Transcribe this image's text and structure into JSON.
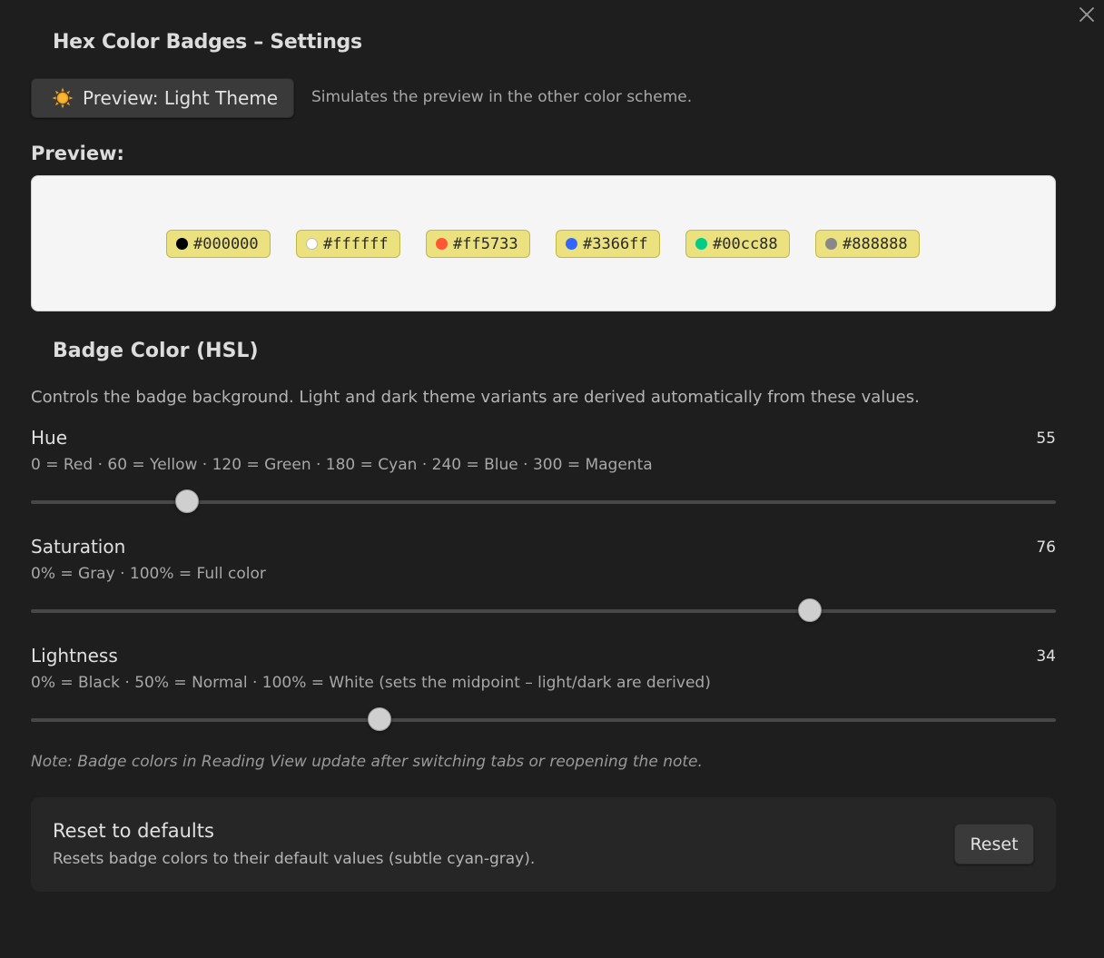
{
  "header": {
    "title": "Hex Color Badges – Settings"
  },
  "icons": {
    "close": "close-icon",
    "theme": "sun-icon"
  },
  "preview_toggle": {
    "label": "Preview: Light Theme",
    "description": "Simulates the preview in the other color scheme."
  },
  "preview": {
    "heading": "Preview:",
    "background": "#f5f5f5",
    "badge_background": "#ebe17e",
    "badges": [
      {
        "label": "#000000",
        "color": "#000000"
      },
      {
        "label": "#ffffff",
        "color": "#ffffff"
      },
      {
        "label": "#ff5733",
        "color": "#ff5733"
      },
      {
        "label": "#3366ff",
        "color": "#3366ff"
      },
      {
        "label": "#00cc88",
        "color": "#00cc88"
      },
      {
        "label": "#888888",
        "color": "#888888"
      }
    ]
  },
  "badge_color": {
    "title": "Badge Color (HSL)",
    "description": "Controls the badge background. Light and dark theme variants are derived automatically from these values.",
    "sliders": [
      {
        "label": "Hue",
        "value": "55",
        "numeric": 55,
        "min": 0,
        "max": 360,
        "hint": "0 = Red · 60 = Yellow · 120 = Green · 180 = Cyan · 240 = Blue · 300 = Magenta"
      },
      {
        "label": "Saturation",
        "value": "76",
        "numeric": 76,
        "min": 0,
        "max": 100,
        "hint": "0% = Gray · 100% = Full color"
      },
      {
        "label": "Lightness",
        "value": "34",
        "numeric": 34,
        "min": 0,
        "max": 100,
        "hint": "0% = Black · 50% = Normal · 100% = White (sets the midpoint – light/dark are derived)"
      }
    ],
    "note": "Note: Badge colors in Reading View update after switching tabs or reopening the note."
  },
  "reset": {
    "title": "Reset to defaults",
    "description": "Resets badge colors to their default values (subtle cyan-gray).",
    "button_label": "Reset"
  }
}
